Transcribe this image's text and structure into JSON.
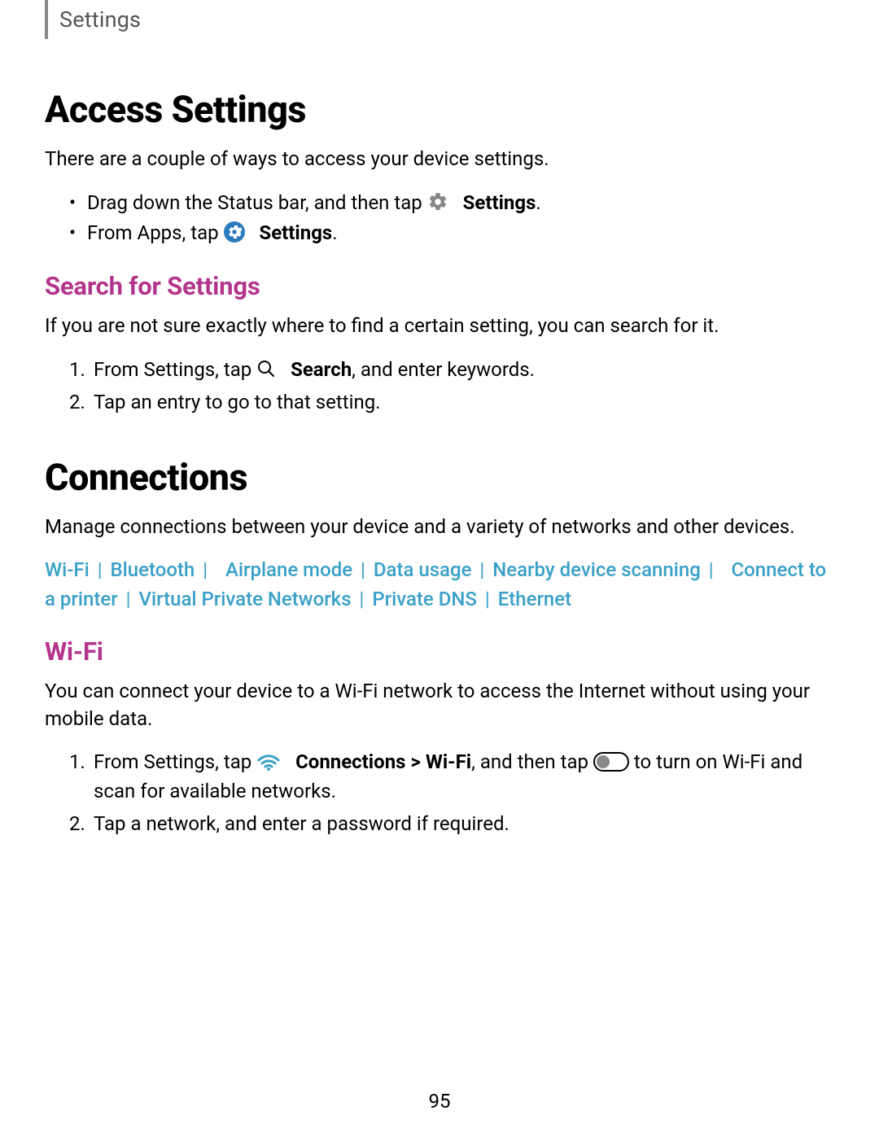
{
  "header": {
    "section_name": "Settings"
  },
  "section1": {
    "title": "Access Settings",
    "intro": "There are a couple of ways to access your device settings.",
    "bullet1_a": "Drag down the Status bar, and then tap ",
    "bullet1_b": "Settings",
    "bullet1_c": ".",
    "bullet2_a": "From Apps, tap ",
    "bullet2_b": "Settings",
    "bullet2_c": "."
  },
  "search": {
    "title": "Search for Settings",
    "intro": "If you are not sure exactly where to find a certain setting, you can search for it.",
    "step1_a": "From Settings, tap ",
    "step1_b": "Search",
    "step1_c": ", and enter keywords.",
    "step2": "Tap an entry to go to that setting."
  },
  "connections": {
    "title": "Connections",
    "intro": "Manage connections between your device and a variety of networks and other devices.",
    "links": [
      "Wi-Fi",
      "Bluetooth",
      "Airplane mode",
      "Data usage",
      "Nearby device scanning",
      "Connect to a printer",
      "Virtual Private Networks",
      "Private DNS",
      "Ethernet"
    ]
  },
  "wifi": {
    "title": "Wi-Fi",
    "intro": "You can connect your device to a Wi-Fi network to access the Internet without using your mobile data.",
    "step1_a": "From Settings, tap ",
    "step1_b": "Connections",
    "step1_arrow": " > ",
    "step1_c": "Wi-Fi",
    "step1_d": ", and then tap ",
    "step1_e": " to turn on Wi-Fi and scan for available networks.",
    "step2": "Tap a network, and enter a password if required."
  },
  "page_number": "95"
}
